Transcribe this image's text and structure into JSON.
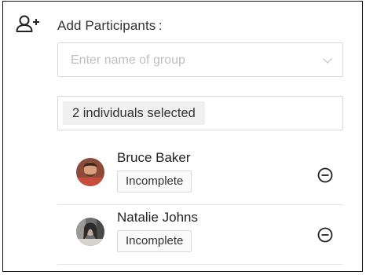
{
  "header": {
    "label": "Add Participants :",
    "icon": "add-user-icon"
  },
  "group_select": {
    "placeholder": "Enter name of group",
    "icon": "chevron-down-icon"
  },
  "selection": {
    "summary": "2 individuals selected"
  },
  "participants": [
    {
      "name": "Bruce Baker",
      "status": "Incomplete",
      "remove_icon": "minus-circle-icon"
    },
    {
      "name": "Natalie Johns",
      "status": "Incomplete",
      "remove_icon": "minus-circle-icon"
    }
  ]
}
